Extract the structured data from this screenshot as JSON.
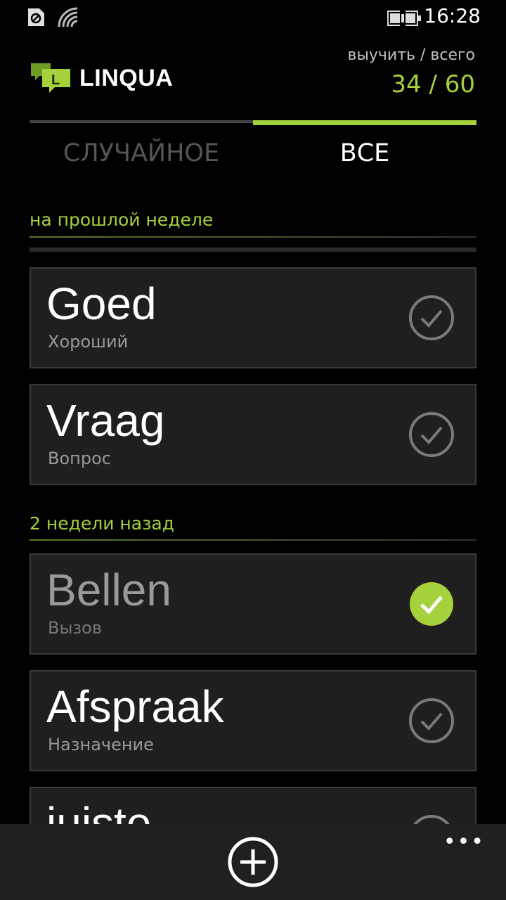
{
  "status_bar": {
    "time": "16:28"
  },
  "header": {
    "app_name": "LINQUA",
    "progress_caption": "выучить / всего",
    "progress_count": "34 / 60"
  },
  "tabs": [
    {
      "label": "СЛУЧАЙНОЕ",
      "active": false
    },
    {
      "label": "ВСЕ",
      "active": true
    }
  ],
  "sections": [
    {
      "header": "на прошлой неделе",
      "words": [
        {
          "word": "Goed",
          "translation": "Хороший",
          "learned": false
        },
        {
          "word": "Vraag",
          "translation": "Вопрос",
          "learned": false
        }
      ]
    },
    {
      "header": "2 недели назад",
      "words": [
        {
          "word": "Bellen",
          "translation": "Вызов",
          "learned": true
        },
        {
          "word": "Afspraak",
          "translation": "Назначение",
          "learned": false
        },
        {
          "word": "juiste",
          "translation": "",
          "learned": false
        }
      ]
    }
  ],
  "colors": {
    "accent": "#a5d13c",
    "card_bg": "#1f1f1f",
    "background": "#000000"
  },
  "app_bar": {
    "add_icon": "add-circle-icon",
    "more_icon": "more-dots-icon",
    "more_label": "•••"
  }
}
